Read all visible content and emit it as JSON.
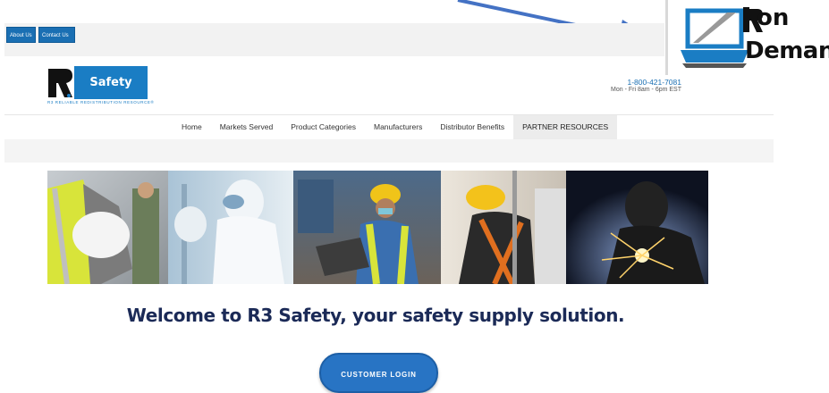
{
  "topbar": {
    "about_label": "About Us",
    "contact_label": "Contact Us"
  },
  "ondemand": {
    "line1": "on",
    "line2": "Demand"
  },
  "logo": {
    "brand": "Safety",
    "tagline": "R3 RELIABLE REDISTRIBUTION RESOURCE®"
  },
  "contact": {
    "phone": "1-800-421-7081",
    "hours": "Mon - Fri 8am - 6pm EST"
  },
  "nav": {
    "items": [
      "Home",
      "Markets Served",
      "Product Categories",
      "Manufacturers",
      "Distributor Benefits",
      "PARTNER RESOURCES"
    ]
  },
  "welcome": "Welcome to R3 Safety, your safety supply solution.",
  "login_label": "CUSTOMER LOGIN",
  "colors": {
    "brand_blue": "#1a7dc4",
    "heading_navy": "#1b2a57",
    "arrow_blue": "#4472c4"
  }
}
